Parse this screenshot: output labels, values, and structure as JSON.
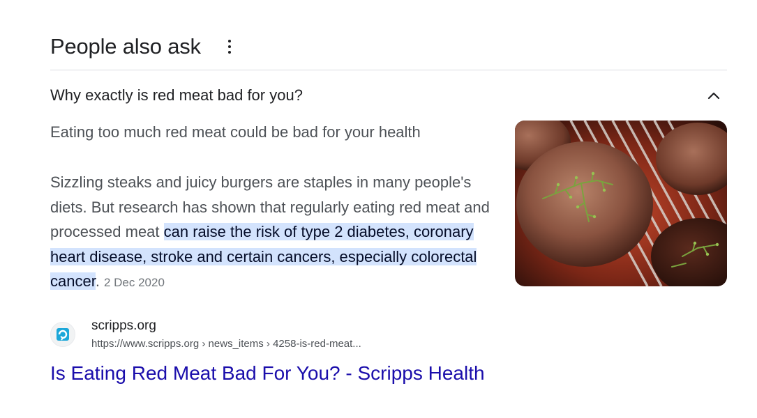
{
  "section": {
    "title": "People also ask"
  },
  "question": {
    "text": "Why exactly is red meat bad for you?"
  },
  "answer": {
    "heading": "Eating too much red meat could be bad for your health",
    "body_plain": "Sizzling steaks and juicy burgers are staples in many people's diets. But research has shown that regularly eating red meat and processed meat ",
    "body_highlight": "can raise the risk of type 2 diabetes, coronary heart disease, stroke and certain cancers, especially colorectal cancer",
    "body_end": ".",
    "date": "2 Dec 2020"
  },
  "source": {
    "site_name": "scripps.org",
    "url": "https://www.scripps.org › news_items › 4258-is-red-meat...",
    "favicon": "scripps-favicon"
  },
  "result": {
    "title": "Is Eating Red Meat Bad For You? - Scripps Health"
  },
  "icons": {
    "more": "more-vert-icon",
    "collapse": "chevron-up-icon"
  },
  "colors": {
    "link": "#1a0dab",
    "highlight": "#d3e3fd",
    "divider": "#dadce0",
    "favicon_accent": "#1ba7d9"
  }
}
